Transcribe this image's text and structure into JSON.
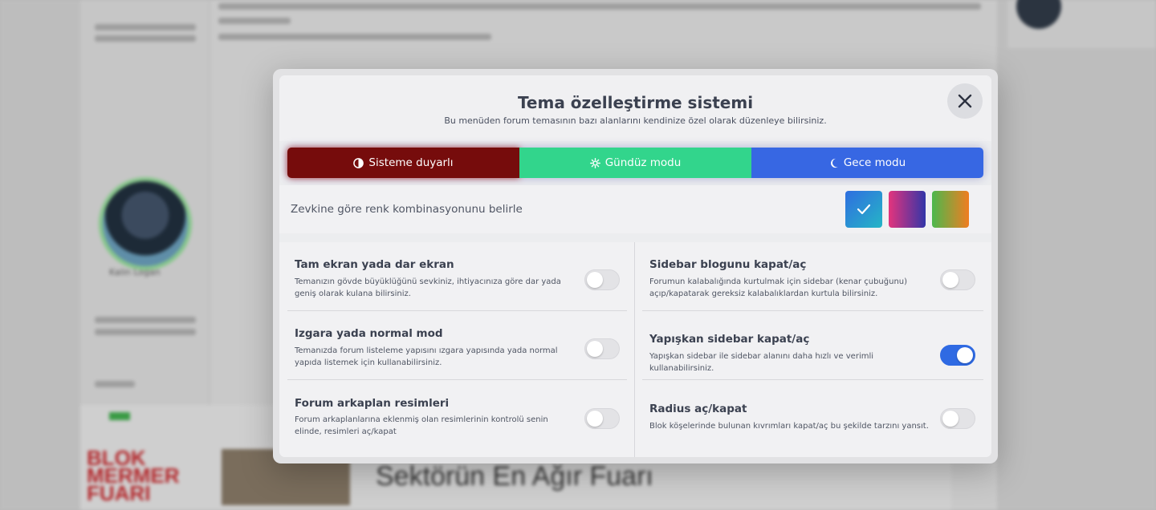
{
  "modal": {
    "title": "Tema özelleştirme sistemi",
    "subtitle": "Bu menüden forum temasının bazı alanlarını kendinize özel olarak düzenleye bilirsiniz.",
    "close_icon": "close-icon"
  },
  "modes": {
    "system": {
      "label": "Sisteme duyarlı",
      "icon": "half-circle-icon",
      "color": "#760c0c"
    },
    "day": {
      "label": "Gündüz modu",
      "icon": "sun-icon",
      "color": "#32d58c"
    },
    "night": {
      "label": "Gece modu",
      "icon": "moon-icon",
      "color": "#3767e3"
    }
  },
  "colors": {
    "label": "Zevkine göre renk kombinasyonunu belirle",
    "swatches": [
      {
        "name": "blue",
        "selected": true
      },
      {
        "name": "pink-purple",
        "selected": false
      },
      {
        "name": "green-orange",
        "selected": false
      }
    ]
  },
  "settings": [
    {
      "title": "Tam ekran yada dar ekran",
      "desc": "Temanızın gövde büyüklüğünü sevkiniz, ihtiyacınıza göre dar yada geniş olarak kulana bilirsiniz.",
      "enabled": false
    },
    {
      "title": "Sidebar blogunu kapat/aç",
      "desc": "Forumun kalabalığında kurtulmak için sidebar (kenar çubuğunu) açıp/kapatarak gereksiz kalabalıklardan kurtula bilirsiniz.",
      "enabled": false
    },
    {
      "title": "Izgara yada normal mod",
      "desc": "Temanızda forum listeleme yapısını ızgara yapısında yada normal yapıda listemek için kullanabilirsiniz.",
      "enabled": false
    },
    {
      "title": "Yapışkan sidebar kapat/aç",
      "desc": "Yapışkan sidebar ile sidebar alanını daha hızlı ve verimli kullanabilirsiniz.",
      "enabled": true
    },
    {
      "title": "Forum arkaplan resimleri",
      "desc": "Forum arkaplanlarına eklenmiş olan resimlerinin kontrolü senin elinde, resimleri aç/kapat",
      "enabled": false
    },
    {
      "title": "Radius aç/kapat",
      "desc": "Blok köşelerinde bulunan kıvrımları kapat/aç bu şekilde tarzını yansıt.",
      "enabled": false
    }
  ],
  "background": {
    "profile_name": "Kalin Logan",
    "banner_left": "BLOK MERMER FUARI",
    "banner_text": "Sektörün En Ağır Fuarı"
  },
  "accent_color": "#2f6ae3"
}
